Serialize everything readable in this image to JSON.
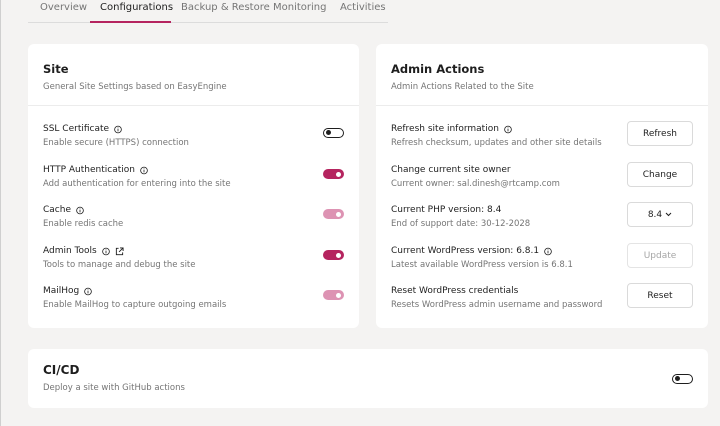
{
  "tabs": [
    {
      "label": "Overview"
    },
    {
      "label": "Configurations"
    },
    {
      "label": "Backup & Restore"
    },
    {
      "label": "Monitoring"
    },
    {
      "label": "Activities"
    }
  ],
  "active_tab": "Configurations",
  "accent_color": "#b5245f",
  "site_card": {
    "title": "Site",
    "subtitle": "General Site Settings based on EasyEngine",
    "settings": [
      {
        "title": "SSL Certificate",
        "description": "Enable secure (HTTPS) connection",
        "state": "off"
      },
      {
        "title": "HTTP Authentication",
        "description": "Add authentication for entering into the site",
        "state": "on"
      },
      {
        "title": "Cache",
        "description": "Enable redis cache",
        "state": "on-disabled"
      },
      {
        "title": "Admin Tools",
        "description": "Tools to manage and debug the site",
        "state": "on"
      },
      {
        "title": "MailHog",
        "description": "Enable MailHog to capture outgoing emails",
        "state": "on-disabled"
      }
    ]
  },
  "admin_card": {
    "title": "Admin Actions",
    "subtitle": "Admin Actions Related to the Site",
    "actions": [
      {
        "title": "Refresh site information",
        "description": "Refresh checksum, updates and other site details",
        "button": "Refresh"
      },
      {
        "title": "Change current site owner",
        "description": "Current owner: sal.dinesh@rtcamp.com",
        "button": "Change"
      },
      {
        "title": "Current PHP version: 8.4",
        "description": "End of support date: 30-12-2028",
        "button": "8.4"
      },
      {
        "title": "Current WordPress version: 6.8.1",
        "description": "Latest available WordPress version is 6.8.1",
        "button": "Update"
      },
      {
        "title": "Reset WordPress credentials",
        "description": "Resets WordPress admin username and password",
        "button": "Reset"
      }
    ]
  },
  "cicd_card": {
    "title": "CI/CD",
    "subtitle": "Deploy a site with GitHub actions",
    "state": "off"
  }
}
